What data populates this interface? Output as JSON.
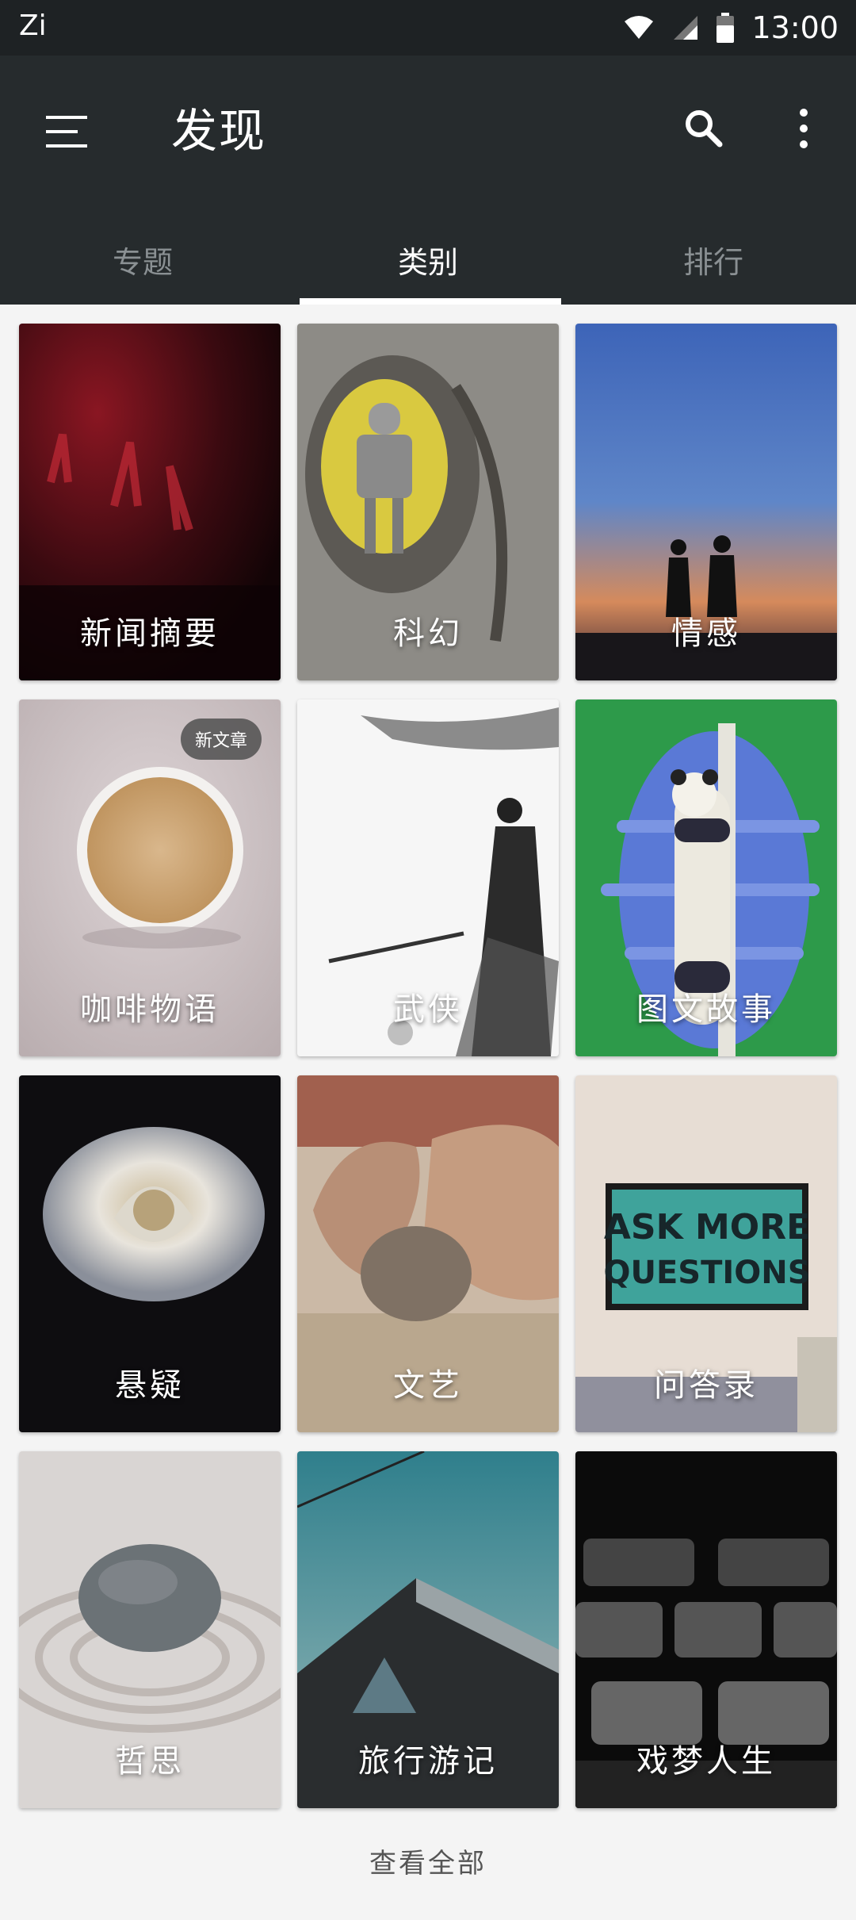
{
  "status": {
    "carrier": "Zi",
    "time": "13:00"
  },
  "app_bar": {
    "title": "发现"
  },
  "tabs": [
    {
      "label": "专题",
      "active": false
    },
    {
      "label": "类别",
      "active": true
    },
    {
      "label": "排行",
      "active": false
    }
  ],
  "categories": [
    {
      "label": "新闻摘要"
    },
    {
      "label": "科幻"
    },
    {
      "label": "情感"
    },
    {
      "label": "咖啡物语",
      "badge": "新文章"
    },
    {
      "label": "武侠"
    },
    {
      "label": "图文故事"
    },
    {
      "label": "悬疑"
    },
    {
      "label": "文艺"
    },
    {
      "label": "问答录",
      "poster_text": [
        "ASK MORE",
        "QUESTIONS"
      ]
    },
    {
      "label": "哲思"
    },
    {
      "label": "旅行游记"
    },
    {
      "label": "戏梦人生"
    }
  ],
  "footer": {
    "view_all": "查看全部"
  },
  "colors": {
    "app_bar": "#262b2d",
    "status_bar": "#1e2224",
    "background": "#f4f4f4"
  }
}
